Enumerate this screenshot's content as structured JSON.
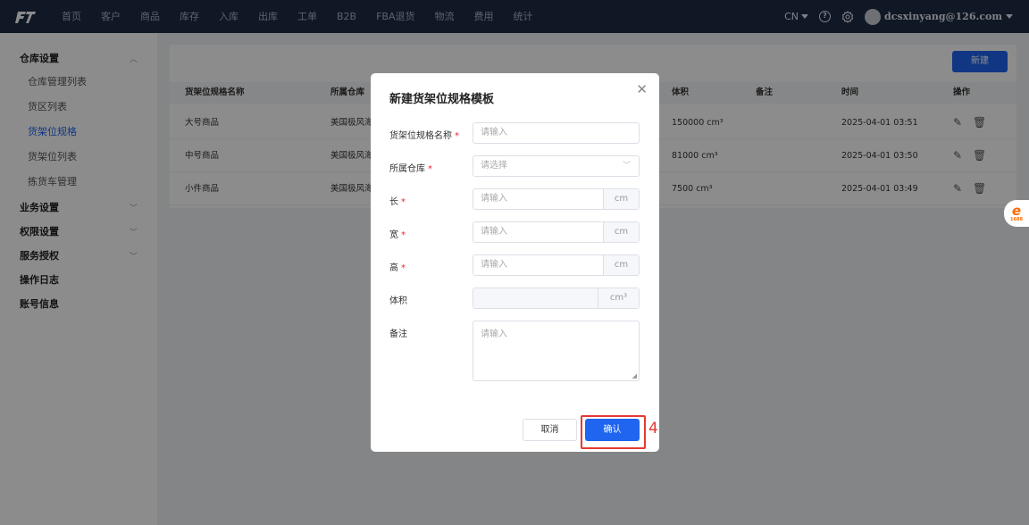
{
  "nav": {
    "items": [
      "首页",
      "客户",
      "商品",
      "库存",
      "入库",
      "出库",
      "工单",
      "B2B",
      "FBA退货",
      "物流",
      "费用",
      "统计"
    ],
    "lang": "CN",
    "user": "dcsxinyang@126.com"
  },
  "sidebar": {
    "group_warehouse": "仓库设置",
    "items": [
      "仓库管理列表",
      "货区列表",
      "货架位规格",
      "货架位列表",
      "拣货车管理"
    ],
    "group_business": "业务设置",
    "group_permission": "权限设置",
    "group_service": "服务授权",
    "group_log": "操作日志",
    "group_account": "账号信息"
  },
  "table": {
    "new_button": "新建",
    "headers": {
      "name": "货架位规格名称",
      "warehouse": "所属仓库",
      "volume": "体积",
      "remark": "备注",
      "time": "时间",
      "ops": "操作"
    },
    "rows": [
      {
        "name": "大号商品",
        "warehouse": "美国极风海",
        "volume": "150000 cm³",
        "remark": "",
        "time": "2025-04-01 03:51"
      },
      {
        "name": "中号商品",
        "warehouse": "美国极风海",
        "volume": "81000 cm³",
        "remark": "",
        "time": "2025-04-01 03:50"
      },
      {
        "name": "小件商品",
        "warehouse": "美国极风海",
        "volume": "7500 cm³",
        "remark": "",
        "time": "2025-04-01 03:49"
      }
    ]
  },
  "modal": {
    "title": "新建货架位规格模板",
    "fields": {
      "name_label": "货架位规格名称",
      "name_placeholder": "请输入",
      "warehouse_label": "所属仓库",
      "warehouse_placeholder": "请选择",
      "length_label": "长",
      "length_placeholder": "请输入",
      "width_label": "宽",
      "width_placeholder": "请输入",
      "height_label": "高",
      "height_placeholder": "请输入",
      "volume_label": "体积",
      "remark_label": "备注",
      "remark_placeholder": "请输入"
    },
    "required_mark": "*",
    "unit_cm": "cm",
    "unit_cm3": "cm³",
    "cancel": "取消",
    "confirm": "确认"
  },
  "annotation": {
    "step": "4",
    "color": "#e53935"
  },
  "colors": {
    "primary": "#1f65f0",
    "topbar": "#1e2a44",
    "required": "#f5222d"
  },
  "icons": {
    "edit": "edit-icon",
    "delete": "trash-icon",
    "close": "close-icon",
    "help": "help-icon",
    "settings": "gear-icon"
  }
}
